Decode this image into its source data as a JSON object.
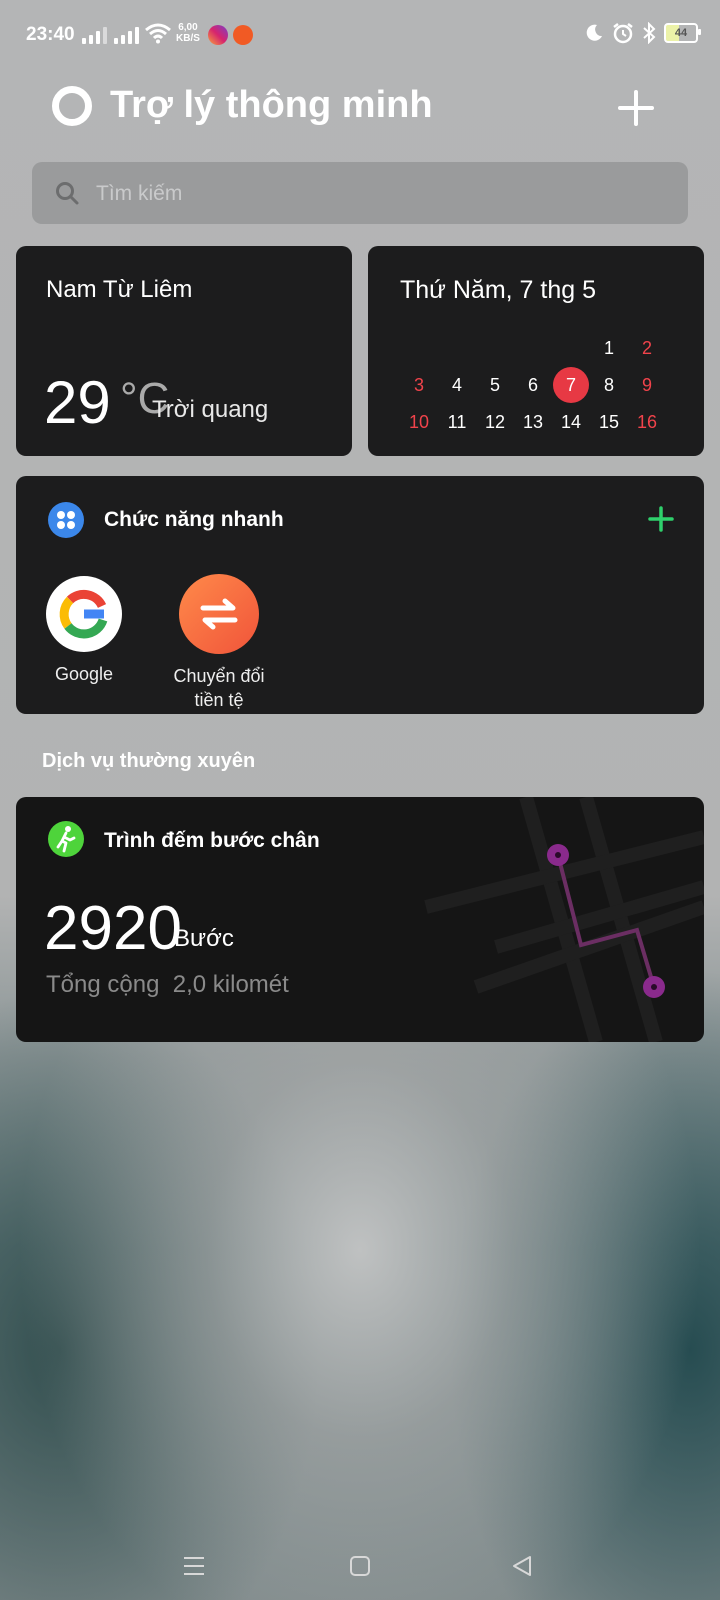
{
  "status_bar": {
    "time": "23:40",
    "net_speed_value": "6,00",
    "net_speed_unit": "KB/S",
    "battery": "44"
  },
  "header": {
    "title": "Trợ lý thông minh"
  },
  "search": {
    "placeholder": "Tìm kiếm"
  },
  "weather": {
    "location": "Nam Từ Liêm",
    "temperature": "29",
    "unit": "°C",
    "condition": "Trời quang"
  },
  "calendar": {
    "date_label": "Thứ Năm, 7 thg 5",
    "weeks": [
      [
        "",
        "",
        "",
        "",
        "",
        "1",
        "2"
      ],
      [
        "3",
        "4",
        "5",
        "6",
        "7",
        "8",
        "9"
      ],
      [
        "10",
        "11",
        "12",
        "13",
        "14",
        "15",
        "16"
      ]
    ],
    "today": "7"
  },
  "quick_functions": {
    "title": "Chức năng nhanh",
    "apps": [
      {
        "label": "Google"
      },
      {
        "label_line1": "Chuyển đổi",
        "label_line2": "tiền tệ"
      }
    ]
  },
  "section_title": "Dịch vụ thường xuyên",
  "step_counter": {
    "title": "Trình đếm bước chân",
    "steps": "2920",
    "unit": "Bước",
    "total_label": "Tổng cộng",
    "distance": "2,0 kilomét"
  },
  "colors": {
    "accent_green": "#2fd06c",
    "today_red": "#e73944",
    "weekend_red": "#f0434b"
  }
}
